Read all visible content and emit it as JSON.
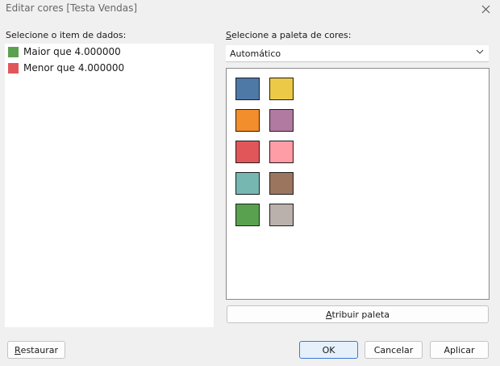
{
  "window": {
    "title": "Editar cores [Testa Vendas]"
  },
  "data_items": {
    "label": "Selecione o item de dados:",
    "items": [
      {
        "label": "Maior que 4.000000",
        "color": "#59a14f"
      },
      {
        "label": "Menor que 4.000000",
        "color": "#e15759"
      }
    ]
  },
  "palette": {
    "label_underlined": "S",
    "label_rest": "elecione a paleta de cores:",
    "selected": "Automático",
    "colors": [
      "#4e79a7",
      "#edc948",
      "#f28e2b",
      "#b07aa1",
      "#e15759",
      "#ff9da7",
      "#76b7b2",
      "#9c755f",
      "#59a14f",
      "#bab0ac"
    ]
  },
  "buttons": {
    "assign_u": "A",
    "assign_rest": "tribuir paleta",
    "reset_u": "R",
    "reset_rest": "estaurar",
    "ok": "OK",
    "cancel": "Cancelar",
    "apply": "Aplicar"
  }
}
